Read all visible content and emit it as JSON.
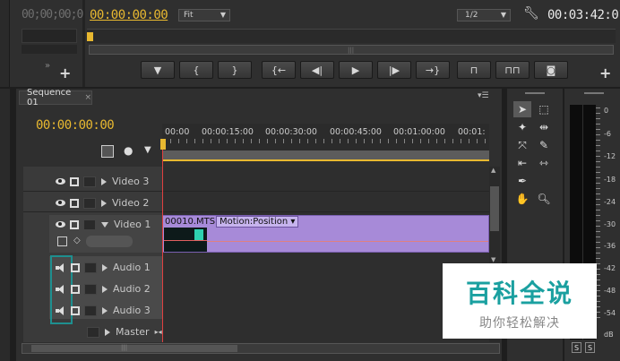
{
  "source_monitor": {
    "timecode": "00;00;00;0"
  },
  "program_monitor": {
    "timecode": "00:00:00:00",
    "fit_label": "Fit",
    "resolution_label": "1/2",
    "duration": "00:03:42:01"
  },
  "sequence": {
    "tab_label": "Sequence 01",
    "playhead_timecode": "00:00:00:00",
    "ruler": [
      "00:00",
      "00:00:15:00",
      "00:00:30:00",
      "00:00:45:00",
      "00:01:00:00",
      "00:01:"
    ]
  },
  "tracks": {
    "video3": "Video 3",
    "video2": "Video 2",
    "video1": "Video 1",
    "audio1": "Audio 1",
    "audio2": "Audio 2",
    "audio3": "Audio 3",
    "master": "Master"
  },
  "clip": {
    "name": "00010.MTS",
    "effect_label": "Motion:Position ▾",
    "color": "#a78ad8"
  },
  "vu_scale": [
    "0",
    "-6",
    "-12",
    "-18",
    "-24",
    "-30",
    "-36",
    "-42",
    "-48",
    "-54",
    "dB"
  ],
  "vu_buttons": [
    "S",
    "S"
  ],
  "watermark": {
    "title": "百科全说",
    "subtitle": "助你轻松解决"
  }
}
